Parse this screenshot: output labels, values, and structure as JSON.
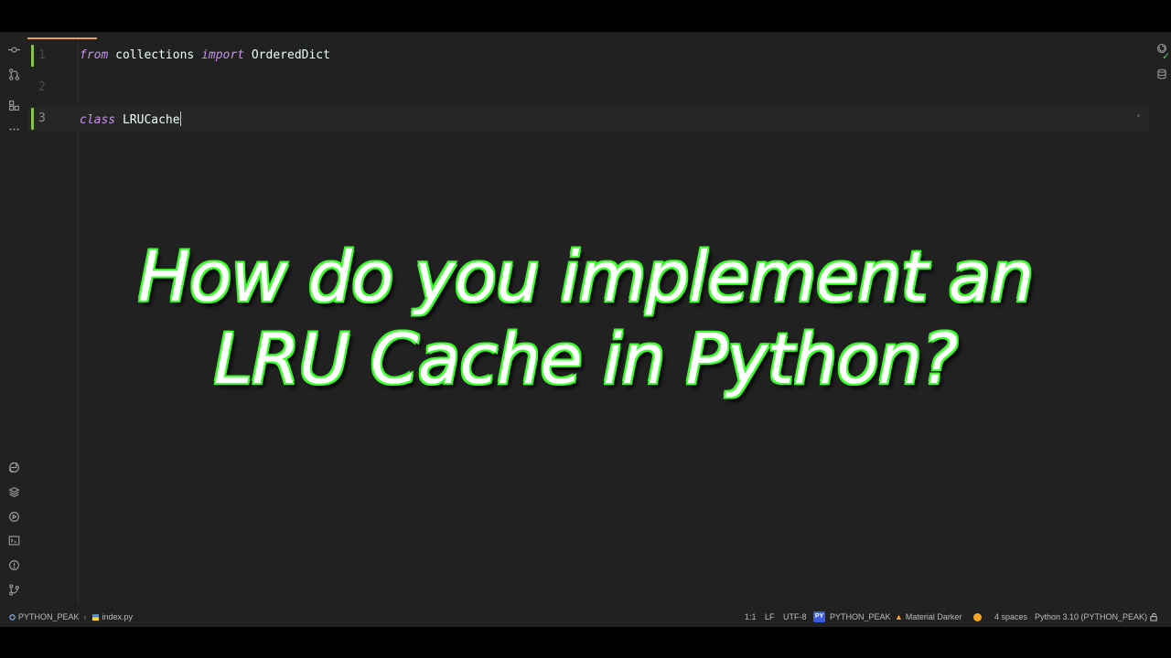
{
  "editor": {
    "lines": [
      {
        "number": "1",
        "tokens": [
          {
            "text": "from",
            "kind": "keyword"
          },
          {
            "text": " collections ",
            "kind": "plain"
          },
          {
            "text": "import",
            "kind": "keyword"
          },
          {
            "text": " OrderedDict",
            "kind": "plain"
          }
        ]
      },
      {
        "number": "2",
        "tokens": []
      },
      {
        "number": "3",
        "tokens": [
          {
            "text": "class",
            "kind": "keyword"
          },
          {
            "text": " LRUCache",
            "kind": "plain"
          }
        ]
      }
    ]
  },
  "headline": {
    "line1": "How do you implement an",
    "line2": "LRU Cache in Python?"
  },
  "statusbar": {
    "project": "PYTHON_PEAK",
    "file": "index.py",
    "position": "1:1",
    "line_separator": "LF",
    "encoding": "UTF-8",
    "interpreter_badge": "PY",
    "interpreter_project": "PYTHON_PEAK",
    "theme": "Material Darker",
    "indent": "4 spaces",
    "interpreter": "Python 3.10 (PYTHON_PEAK)"
  },
  "colors": {
    "background": "#212121",
    "keyword": "#c792ea",
    "text": "#eeffff",
    "headline_glow": "#3bff2a",
    "tab_accent": "#e2a05a",
    "change_marker": "#8bc34a"
  },
  "icons": {
    "left_top": [
      "commit-icon",
      "pull-requests-icon",
      "structure-icon",
      "more-icon"
    ],
    "left_bottom": [
      "python-packages-icon",
      "layers-icon",
      "run-icon",
      "terminal-icon",
      "problems-icon",
      "git-icon"
    ],
    "right": [
      "notifications-icon",
      "ai-assistant-icon",
      "database-icon"
    ]
  }
}
